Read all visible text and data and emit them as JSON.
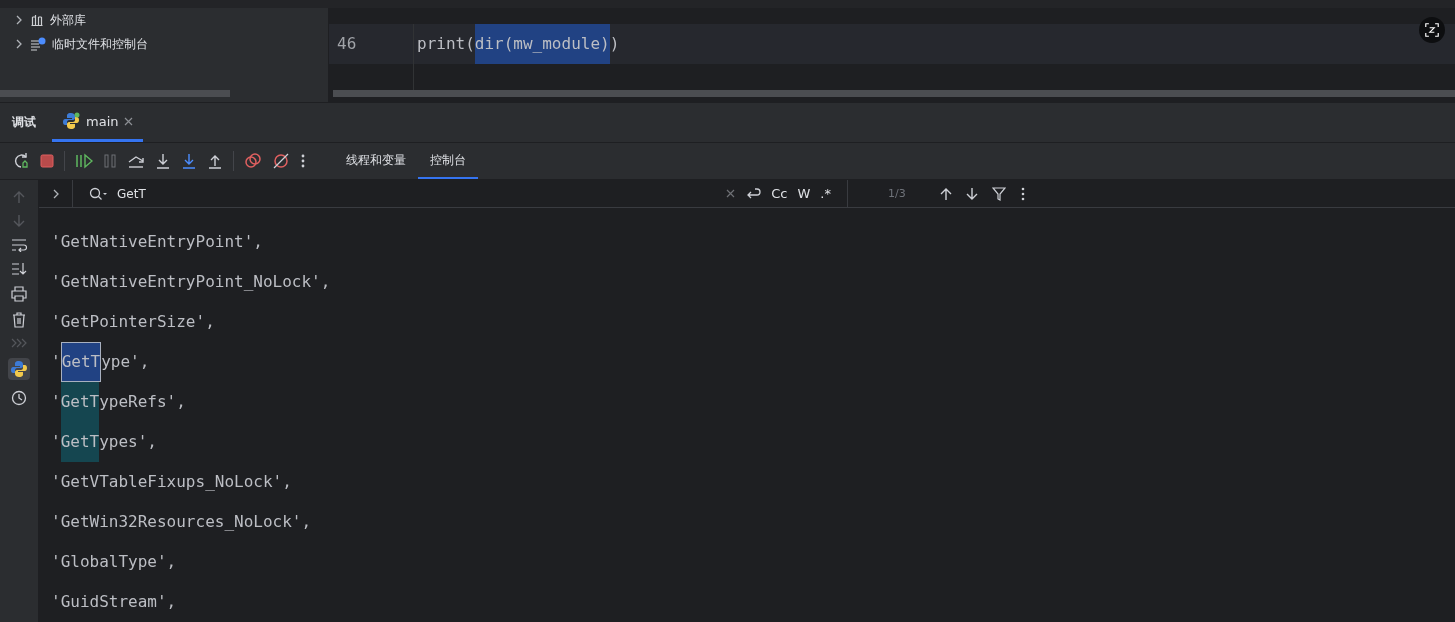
{
  "project_tree": {
    "items": [
      {
        "label": "外部库",
        "kind": "library",
        "expanded": false
      },
      {
        "label": "临时文件和控制台",
        "kind": "scratch",
        "expanded": false
      }
    ]
  },
  "editor": {
    "lines": [
      {
        "number": "46",
        "current": true,
        "segments": [
          {
            "text": "print(",
            "highlight": false
          },
          {
            "text": "dir(mw_module)",
            "highlight": true
          },
          {
            "text": ")",
            "highlight": false
          }
        ]
      }
    ]
  },
  "debug_panel": {
    "title": "调试",
    "tabs": [
      {
        "label": "main",
        "selected": true
      }
    ],
    "view_tabs": [
      {
        "label": "线程和变量",
        "selected": false
      },
      {
        "label": "控制台",
        "selected": true
      }
    ]
  },
  "search": {
    "value": "GetT",
    "options": [
      "Cc",
      "W",
      ".*"
    ],
    "match_count": "1/3"
  },
  "console": {
    "lines": [
      {
        "segments": [
          {
            "text": "'GetNativeEntryPoint',",
            "match": false
          }
        ]
      },
      {
        "segments": [
          {
            "text": "'GetNativeEntryPoint_NoLock',",
            "match": false
          }
        ]
      },
      {
        "segments": [
          {
            "text": "'GetPointerSize',",
            "match": false
          }
        ]
      },
      {
        "segments": [
          {
            "text": "'",
            "match": false
          },
          {
            "text": "GetT",
            "match": true,
            "current": true
          },
          {
            "text": "ype',",
            "match": false
          }
        ]
      },
      {
        "segments": [
          {
            "text": "'",
            "match": false
          },
          {
            "text": "GetT",
            "match": true,
            "current": false
          },
          {
            "text": "ypeRefs',",
            "match": false
          }
        ]
      },
      {
        "segments": [
          {
            "text": "'",
            "match": false
          },
          {
            "text": "GetT",
            "match": true,
            "current": false
          },
          {
            "text": "ypes',",
            "match": false
          }
        ]
      },
      {
        "segments": [
          {
            "text": "'GetVTableFixups_NoLock',",
            "match": false
          }
        ]
      },
      {
        "segments": [
          {
            "text": "'GetWin32Resources_NoLock',",
            "match": false
          }
        ]
      },
      {
        "segments": [
          {
            "text": "'GlobalType',",
            "match": false
          }
        ]
      },
      {
        "segments": [
          {
            "text": "'GuidStream',",
            "match": false
          }
        ]
      }
    ]
  }
}
